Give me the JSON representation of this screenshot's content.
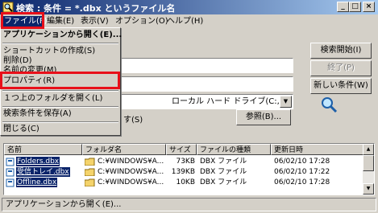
{
  "window": {
    "title": "検索 : 条件 = *.dbx というファイル名"
  },
  "menubar": {
    "items": [
      "ファイル(F)",
      "編集(E)",
      "表示(V)",
      "オプション(O)",
      "ヘルプ(H)"
    ],
    "file_label": "ファイル(F)",
    "edit_label": "編集(E)",
    "view_label": "表示(V)",
    "options_label": "オプション(O)",
    "help_label": "ヘルプ(H)"
  },
  "file_menu": {
    "items": [
      "アプリケーションから開く(E)...",
      "ショートカットの作成(S)",
      "削除(D)",
      "名前の変更(M)",
      "プロパティ(R)",
      "１つ上のフォルダを開く(L)",
      "検索条件を保存(A)",
      "閉じる(C)"
    ]
  },
  "search_form": {
    "look_in_value": "ローカル ハード ドライブ(C:,D:)",
    "browse_label": "参照(B)...",
    "subfolder_label": "す(S)"
  },
  "buttons": {
    "search_start": "検索開始(I)",
    "stop": "終了(P)",
    "new_search": "新しい条件(W)"
  },
  "results": {
    "columns": [
      "名前",
      "フォルダ名",
      "サイズ",
      "ファイルの種類",
      "更新日時"
    ],
    "rows": [
      {
        "name": "Folders.dbx",
        "folder": "C:¥WINDOWS¥A...",
        "size": "73KB",
        "type": "DBX ファイル",
        "modified": "06/02/10 17:28"
      },
      {
        "name": "受信トレイ.dbx",
        "folder": "C:¥WINDOWS¥A...",
        "size": "139KB",
        "type": "DBX ファイル",
        "modified": "06/02/10 17:22"
      },
      {
        "name": "Offline.dbx",
        "folder": "C:¥WINDOWS¥A...",
        "size": "10KB",
        "type": "DBX ファイル",
        "modified": "06/02/10 17:28"
      }
    ]
  },
  "statusbar": {
    "text": "アプリケーションから開く(E)..."
  },
  "colors": {
    "titlebar": "#0a246a",
    "highlight": "#0a246a",
    "callout": "#e8101a",
    "face": "#d4d0c8"
  }
}
